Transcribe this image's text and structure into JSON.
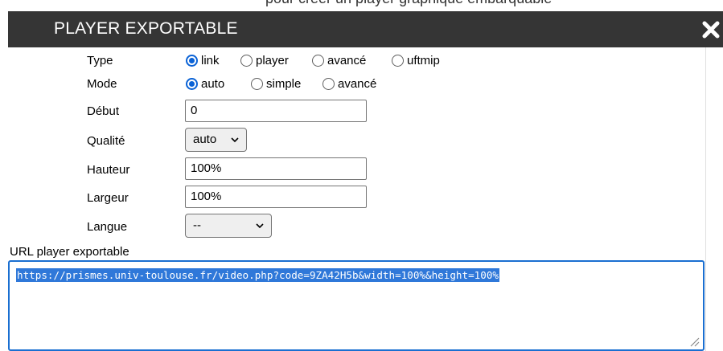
{
  "top_fragment": "pour créer un player graphique embarquable",
  "dialog": {
    "title": "PLAYER EXPORTABLE"
  },
  "form": {
    "type": {
      "label": "Type",
      "options": [
        "link",
        "player",
        "avancé",
        "uftmip"
      ],
      "selected": "link"
    },
    "mode": {
      "label": "Mode",
      "options": [
        "auto",
        "simple",
        "avancé"
      ],
      "selected": "auto"
    },
    "debut": {
      "label": "Début",
      "value": "0"
    },
    "qualite": {
      "label": "Qualité",
      "value": "auto"
    },
    "hauteur": {
      "label": "Hauteur",
      "value": "100%"
    },
    "largeur": {
      "label": "Largeur",
      "value": "100%"
    },
    "langue": {
      "label": "Langue",
      "value": "--"
    }
  },
  "url": {
    "label": "URL player exportable",
    "value": "https://prismes.univ-toulouse.fr/video.php?code=9ZA42H5b&width=100%&height=100%"
  },
  "colors": {
    "titlebar": "#353535",
    "accent": "#0a62d6",
    "selection": "#2f78d9"
  }
}
